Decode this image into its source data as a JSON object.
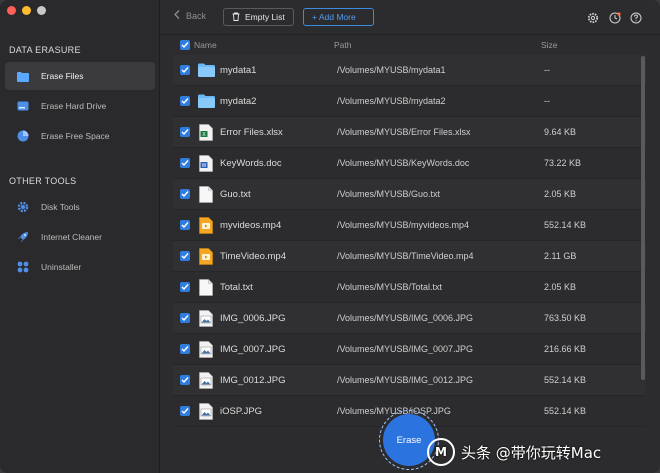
{
  "sidebar": {
    "data_erasure_title": "DATA ERASURE",
    "other_tools_title": "OTHER TOOLS",
    "items": [
      {
        "label": "Erase Files",
        "icon": "folder-icon"
      },
      {
        "label": "Erase Hard Drive",
        "icon": "hard-drive-icon"
      },
      {
        "label": "Erase Free Space",
        "icon": "pie-chart-icon"
      },
      {
        "label": "Disk Tools",
        "icon": "gear-icon"
      },
      {
        "label": "Internet Cleaner",
        "icon": "rocket-icon"
      },
      {
        "label": "Uninstaller",
        "icon": "apps-grid-icon"
      }
    ]
  },
  "toolbar": {
    "back_label": "Back",
    "empty_list_label": "Empty List",
    "add_more_label": "+ Add More"
  },
  "table": {
    "headers": {
      "name": "Name",
      "path": "Path",
      "size": "Size"
    },
    "rows": [
      {
        "name": "mydata1",
        "path": "/Volumes/MYUSB/mydata1",
        "size": "--",
        "type": "folder"
      },
      {
        "name": "mydata2",
        "path": "/Volumes/MYUSB/mydata2",
        "size": "--",
        "type": "folder"
      },
      {
        "name": "Error Files.xlsx",
        "path": "/Volumes/MYUSB/Error Files.xlsx",
        "size": "9.64 KB",
        "type": "xlsx"
      },
      {
        "name": "KeyWords.doc",
        "path": "/Volumes/MYUSB/KeyWords.doc",
        "size": "73.22 KB",
        "type": "doc"
      },
      {
        "name": "Guo.txt",
        "path": "/Volumes/MYUSB/Guo.txt",
        "size": "2.05 KB",
        "type": "txt"
      },
      {
        "name": "myvideos.mp4",
        "path": "/Volumes/MYUSB/myvideos.mp4",
        "size": "552.14 KB",
        "type": "mp4"
      },
      {
        "name": "TimeVideo.mp4",
        "path": "/Volumes/MYUSB/TimeVideo.mp4",
        "size": "2.11 GB",
        "type": "mp4"
      },
      {
        "name": "Total.txt",
        "path": "/Volumes/MYUSB/Total.txt",
        "size": "2.05 KB",
        "type": "txt"
      },
      {
        "name": "IMG_0006.JPG",
        "path": "/Volumes/MYUSB/IMG_0006.JPG",
        "size": "763.50 KB",
        "type": "jpg"
      },
      {
        "name": "IMG_0007.JPG",
        "path": "/Volumes/MYUSB/IMG_0007.JPG",
        "size": "216.66 KB",
        "type": "jpg"
      },
      {
        "name": "IMG_0012.JPG",
        "path": "/Volumes/MYUSB/IMG_0012.JPG",
        "size": "552.14 KB",
        "type": "jpg"
      },
      {
        "name": "iOSP.JPG",
        "path": "/Volumes/MYUSB/iOSP.JPG",
        "size": "552.14 KB",
        "type": "jpg"
      }
    ]
  },
  "erase_label": "Erase",
  "watermark": {
    "text": "头条 @带你玩转Mac",
    "logo": "M"
  },
  "colors": {
    "accent": "#2f7de1",
    "background": "#2c2c2e"
  }
}
